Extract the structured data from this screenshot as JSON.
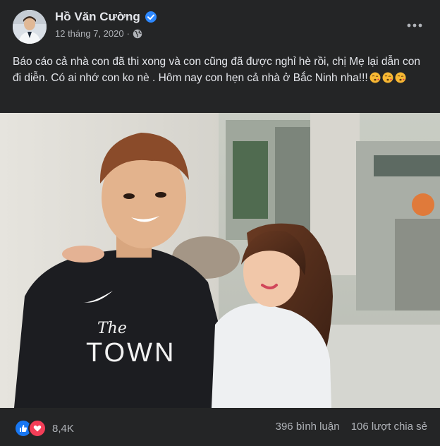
{
  "post": {
    "author_name": "Hồ Văn Cường",
    "date": "12 tháng 7, 2020",
    "separator": "·",
    "privacy_icon": "globe-icon",
    "more_icon": "more-options-icon",
    "caption": "Báo cáo cả nhà con đã thi xong và con cũng đã được nghỉ hè rồi, chị Mẹ lại dẫn con đi diễn. Có ai nhớ con ko nè . Hôm nay con hẹn cả nhà ở Bắc Ninh nha!!!",
    "caption_emojis": [
      "kissing-face-emoji",
      "kissing-face-emoji",
      "kissing-face-emoji"
    ],
    "photo_text": {
      "shirt_line1": "The",
      "shirt_line2": "TOWN"
    }
  },
  "footer": {
    "reaction_icons": [
      "like-icon",
      "love-icon"
    ],
    "reaction_count": "8,4K",
    "comments": "396 bình luận",
    "shares": "106 lượt chia sẻ"
  },
  "colors": {
    "background": "#242526",
    "text_primary": "#e4e6eb",
    "text_secondary": "#b0b3b8",
    "verified_blue": "#2d88ff",
    "like_blue": "#1877f2",
    "love_red": "#f33e58"
  }
}
